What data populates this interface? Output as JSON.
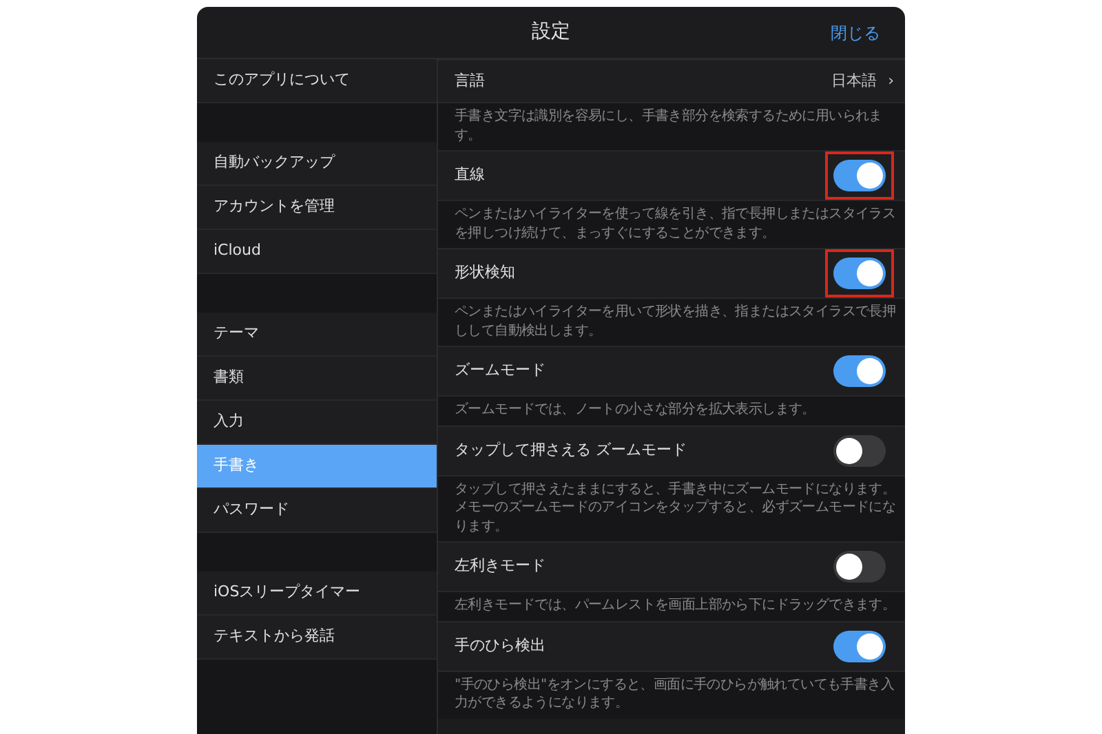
{
  "header": {
    "title": "設定",
    "close": "閉じる"
  },
  "sidebar": {
    "groups": [
      {
        "items": [
          {
            "label": "このアプリについて",
            "selected": false
          }
        ]
      },
      {
        "items": [
          {
            "label": "自動バックアップ",
            "selected": false
          },
          {
            "label": "アカウントを管理",
            "selected": false
          },
          {
            "label": "iCloud",
            "selected": false
          }
        ]
      },
      {
        "items": [
          {
            "label": "テーマ",
            "selected": false
          },
          {
            "label": "書類",
            "selected": false
          },
          {
            "label": "入力",
            "selected": false
          },
          {
            "label": "手書き",
            "selected": true
          },
          {
            "label": "パスワード",
            "selected": false
          }
        ]
      },
      {
        "items": [
          {
            "label": "iOSスリープタイマー",
            "selected": false
          },
          {
            "label": "テキストから発話",
            "selected": false
          }
        ]
      }
    ]
  },
  "settings": [
    {
      "kind": "link",
      "label": "言語",
      "value": "日本語",
      "chevron": "›",
      "description": "手書き文字は識別を容易にし、手書き部分を検索するために用いられます。"
    },
    {
      "kind": "toggle",
      "label": "直線",
      "on": true,
      "highlighted": true,
      "description": "ペンまたはハイライターを使って線を引き、指で長押しまたはスタイラスを押しつけ続けて、まっすぐにすることができます。"
    },
    {
      "kind": "toggle",
      "label": "形状検知",
      "on": true,
      "highlighted": true,
      "description": "ペンまたはハイライターを用いて形状を描き、指またはスタイラスで長押しして自動検出します。"
    },
    {
      "kind": "toggle",
      "label": "ズームモード",
      "on": true,
      "highlighted": false,
      "description": "ズームモードでは、ノートの小さな部分を拡大表示します。"
    },
    {
      "kind": "toggle",
      "label": "タップして押さえる ズームモード",
      "on": false,
      "highlighted": false,
      "description": "タップして押さえたままにすると、手書き中にズームモードになります。メモーのズームモードのアイコンをタップすると、必ずズームモードになります。"
    },
    {
      "kind": "toggle",
      "label": "左利きモード",
      "on": false,
      "highlighted": false,
      "description": "左利きモードでは、パームレストを画面上部から下にドラッグできます。"
    },
    {
      "kind": "toggle",
      "label": "手のひら検出",
      "on": true,
      "highlighted": false,
      "description": "\"手のひら検出\"をオンにすると、画面に手のひらが触れていても手書き入力ができるようになります。"
    }
  ]
}
